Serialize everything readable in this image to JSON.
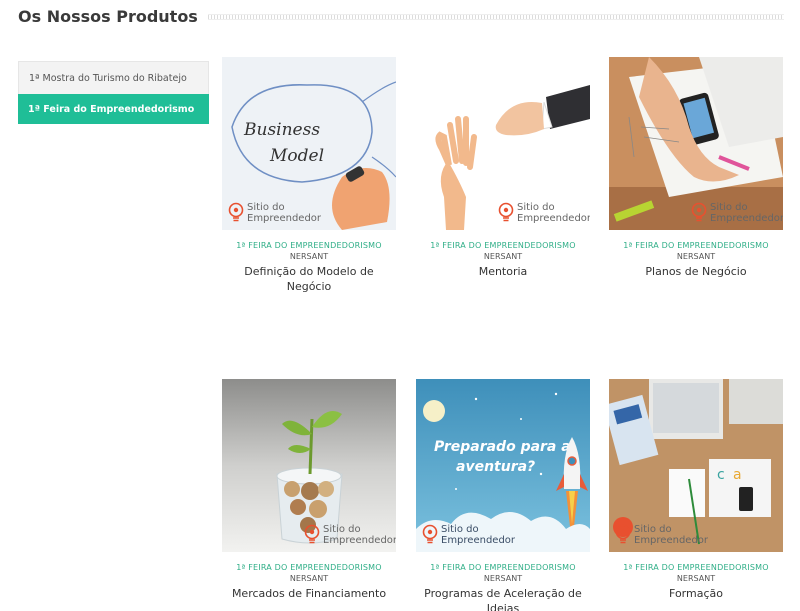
{
  "header": {
    "title": "Os Nossos Produtos"
  },
  "sidebar": {
    "items": [
      {
        "label": "1ª Mostra do Turismo do Ribatejo",
        "active": false
      },
      {
        "label": "1ª Feira do Empreendedorismo",
        "active": true
      }
    ]
  },
  "products": [
    {
      "category": "1ª Feira do Empreendedorismo",
      "brand": "NERSANT",
      "name": "Definição do Modelo de Negócio",
      "image_text": [
        "Business",
        "Model"
      ],
      "logo": [
        "Sitio do",
        "Empreendedor"
      ]
    },
    {
      "category": "1ª Feira do Empreendedorismo",
      "brand": "NERSANT",
      "name": "Mentoria",
      "logo": [
        "Sitio do",
        "Empreendedor"
      ]
    },
    {
      "category": "1ª Feira do Empreendedorismo",
      "brand": "NERSANT",
      "name": "Planos de Negócio",
      "logo": [
        "Sitio do",
        "Empreendedor"
      ]
    },
    {
      "category": "1ª Feira do Empreendedorismo",
      "brand": "NERSANT",
      "name": "Mercados de Financiamento",
      "logo": [
        "Sitio do",
        "Empreendedor"
      ]
    },
    {
      "category": "1ª Feira do Empreendedorismo",
      "brand": "NERSANT",
      "name": "Programas de Aceleração de Ideias",
      "image_text": [
        "Preparado para a",
        "aventura?"
      ],
      "logo": [
        "Sitio do",
        "Empreendedor"
      ]
    },
    {
      "category": "1ª Feira do Empreendedorismo",
      "brand": "NERSANT",
      "name": "Formação",
      "logo": [
        "Sitio do",
        "Empreendedor"
      ]
    }
  ],
  "colors": {
    "accent": "#1fbe97",
    "category_text": "#2fae87"
  }
}
